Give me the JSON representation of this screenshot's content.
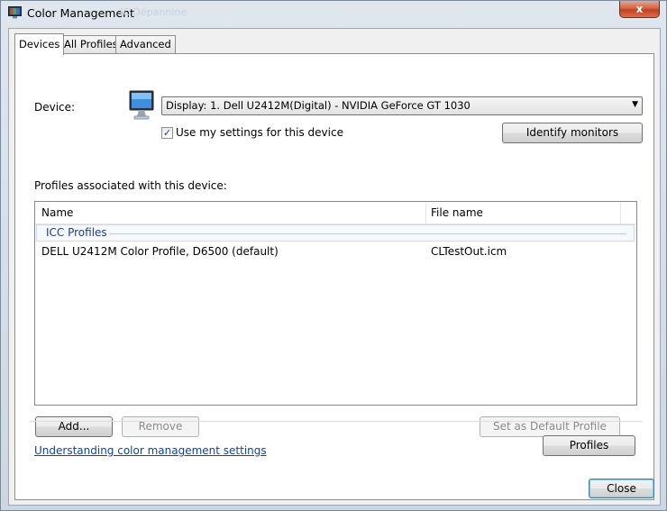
{
  "window": {
    "title": "Color Management",
    "ghost_title": "IC Dépannine",
    "close_glyph": "x"
  },
  "tabs": [
    {
      "label": "Devices",
      "active": true
    },
    {
      "label": "All Profiles",
      "active": false
    },
    {
      "label": "Advanced",
      "active": false
    }
  ],
  "device": {
    "label": "Device:",
    "selected": "Display: 1. Dell U2412M(Digital) - NVIDIA GeForce GT 1030",
    "use_my_settings_label": "Use my settings for this device",
    "use_my_settings_checked": true,
    "identify_button": "Identify monitors"
  },
  "profiles": {
    "section_label": "Profiles associated with this device:",
    "columns": [
      "Name",
      "File name"
    ],
    "group": "ICC Profiles",
    "rows": [
      {
        "name": "DELL U2412M Color Profile, D6500 (default)",
        "file": "CLTestOut.icm"
      }
    ]
  },
  "buttons": {
    "add": "Add...",
    "remove": "Remove",
    "set_default": "Set as Default Profile",
    "profiles": "Profiles",
    "close": "Close"
  },
  "link": "Understanding color management settings",
  "icons": {
    "app": "color-management-icon",
    "monitor": "monitor-icon"
  }
}
